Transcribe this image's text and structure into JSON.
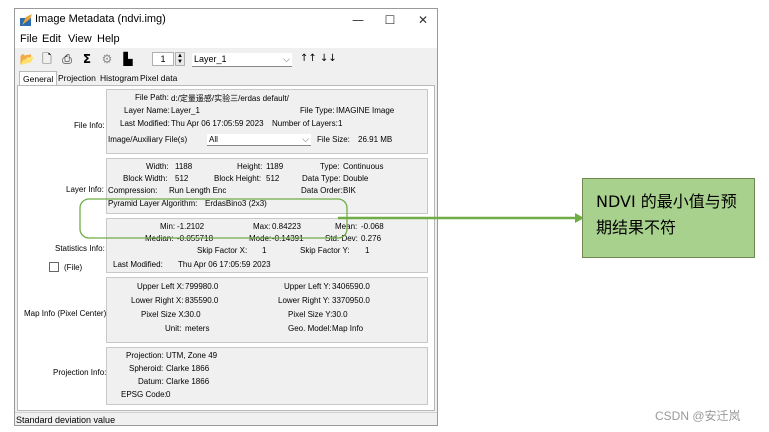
{
  "window": {
    "title": "Image Metadata (ndvi.img)",
    "controls": [
      "—",
      "☐",
      "✕"
    ]
  },
  "menu": [
    "File",
    "Edit",
    "View",
    "Help"
  ],
  "toolbar": {
    "layer_number": "1",
    "layer_select": "Layer_1"
  },
  "tabs": [
    "General",
    "Projection",
    "Histogram",
    "Pixel data"
  ],
  "file_info": {
    "group_label": "File Info:",
    "file_path_label": "File Path:",
    "file_path": "d:/定量遥感/实验三/erdas default/",
    "layer_name_label": "Layer Name:",
    "layer_name": "Layer_1",
    "file_type_label": "File Type:",
    "file_type": "IMAGINE Image",
    "last_modified_label": "Last Modified:",
    "last_modified": "Thu Apr 06 17:05:59 2023",
    "num_layers_label": "Number of Layers:",
    "num_layers": "1",
    "aux_label": "Image/Auxiliary File(s)",
    "aux_value": "All",
    "file_size_label": "File Size:",
    "file_size": "26.91 MB"
  },
  "layer_info": {
    "group_label": "Layer Info:",
    "width_label": "Width:",
    "width": "1188",
    "height_label": "Height:",
    "height": "1189",
    "type_label": "Type:",
    "type": "Continuous",
    "block_width_label": "Block Width:",
    "block_width": "512",
    "block_height_label": "Block Height:",
    "block_height": "512",
    "data_type_label": "Data Type:",
    "data_type": "Double",
    "compression_label": "Compression:",
    "compression": "Run Length Enc",
    "data_order_label": "Data Order:",
    "data_order": "BIK",
    "pyramid_label": "Pyramid Layer Algorithm:",
    "pyramid": "ErdasBino3 (2x3)"
  },
  "statistics_info": {
    "group_label": "Statistics Info:",
    "min_label": "Min:",
    "min": "-1.2102",
    "max_label": "Max:",
    "max": "0.84223",
    "mean_label": "Mean:",
    "mean": "-0.068",
    "median_label": "Median:",
    "median": "-0.055718",
    "mode_label": "Mode:",
    "mode": "-0.14391",
    "std_dev_label": "Std. Dev:",
    "std_dev": "0.276",
    "skip_x_label": "Skip Factor X:",
    "skip_x": "1",
    "skip_y_label": "Skip Factor Y:",
    "skip_y": "1",
    "last_modified_label": "Last Modified:",
    "last_modified": "Thu Apr 06 17:05:59 2023",
    "file_checkbox_label": "(File)"
  },
  "map_info": {
    "group_label": "Map Info (Pixel Center):",
    "upper_left_x_label": "Upper Left X:",
    "upper_left_x": "799980.0",
    "upper_left_y_label": "Upper Left Y:",
    "upper_left_y": "3406590.0",
    "lower_right_x_label": "Lower Right X:",
    "lower_right_x": "835590.0",
    "lower_right_y_label": "Lower Right Y:",
    "lower_right_y": "3370950.0",
    "pixel_size_x_label": "Pixel Size X:",
    "pixel_size_x": "30.0",
    "pixel_size_y_label": "Pixel Size Y:",
    "pixel_size_y": "30.0",
    "unit_label": "Unit:",
    "unit": "meters",
    "geo_model_label": "Geo. Model:",
    "geo_model": "Map Info"
  },
  "projection_info": {
    "group_label": "Projection Info:",
    "projection_label": "Projection:",
    "projection": "UTM, Zone 49",
    "spheroid_label": "Spheroid:",
    "spheroid": "Clarke 1866",
    "datum_label": "Datum:",
    "datum": "Clarke 1866",
    "epsg_label": "EPSG Code:",
    "epsg": "0"
  },
  "status_bar": "Standard deviation value",
  "annotation": {
    "text": "NDVI 的最小值与预期结果不符",
    "box_color": "#a9d18e",
    "line_color": "#70ad47"
  },
  "watermark": "CSDN @安迁岚"
}
